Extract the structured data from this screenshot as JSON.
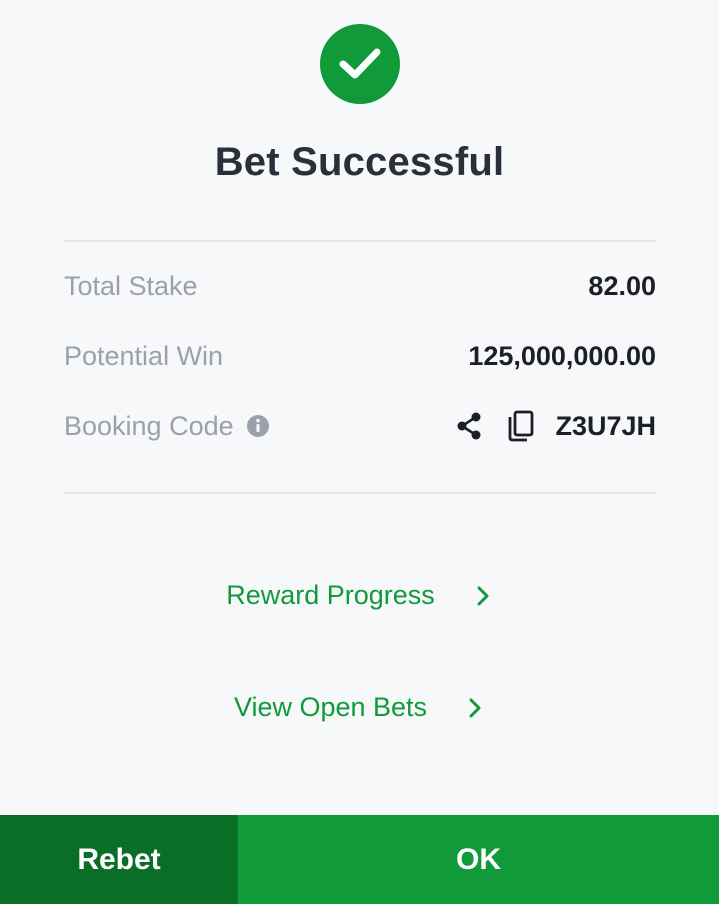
{
  "header": {
    "title": "Bet Successful",
    "icon": "check-circle-icon",
    "accent_color": "#119a3a"
  },
  "summary": {
    "total_stake_label": "Total Stake",
    "total_stake_value": "82.00",
    "potential_win_label": "Potential Win",
    "potential_win_value": "125,000,000.00",
    "booking_code_label": "Booking Code",
    "booking_code_value": "Z3U7JH",
    "icons": [
      "info-icon",
      "share-icon",
      "copy-icon"
    ]
  },
  "links": {
    "reward_progress": "Reward Progress",
    "view_open_bets": "View Open Bets"
  },
  "footer": {
    "rebet_label": "Rebet",
    "ok_label": "OK",
    "rebet_color": "#0a6e27",
    "ok_color": "#119a3a"
  }
}
